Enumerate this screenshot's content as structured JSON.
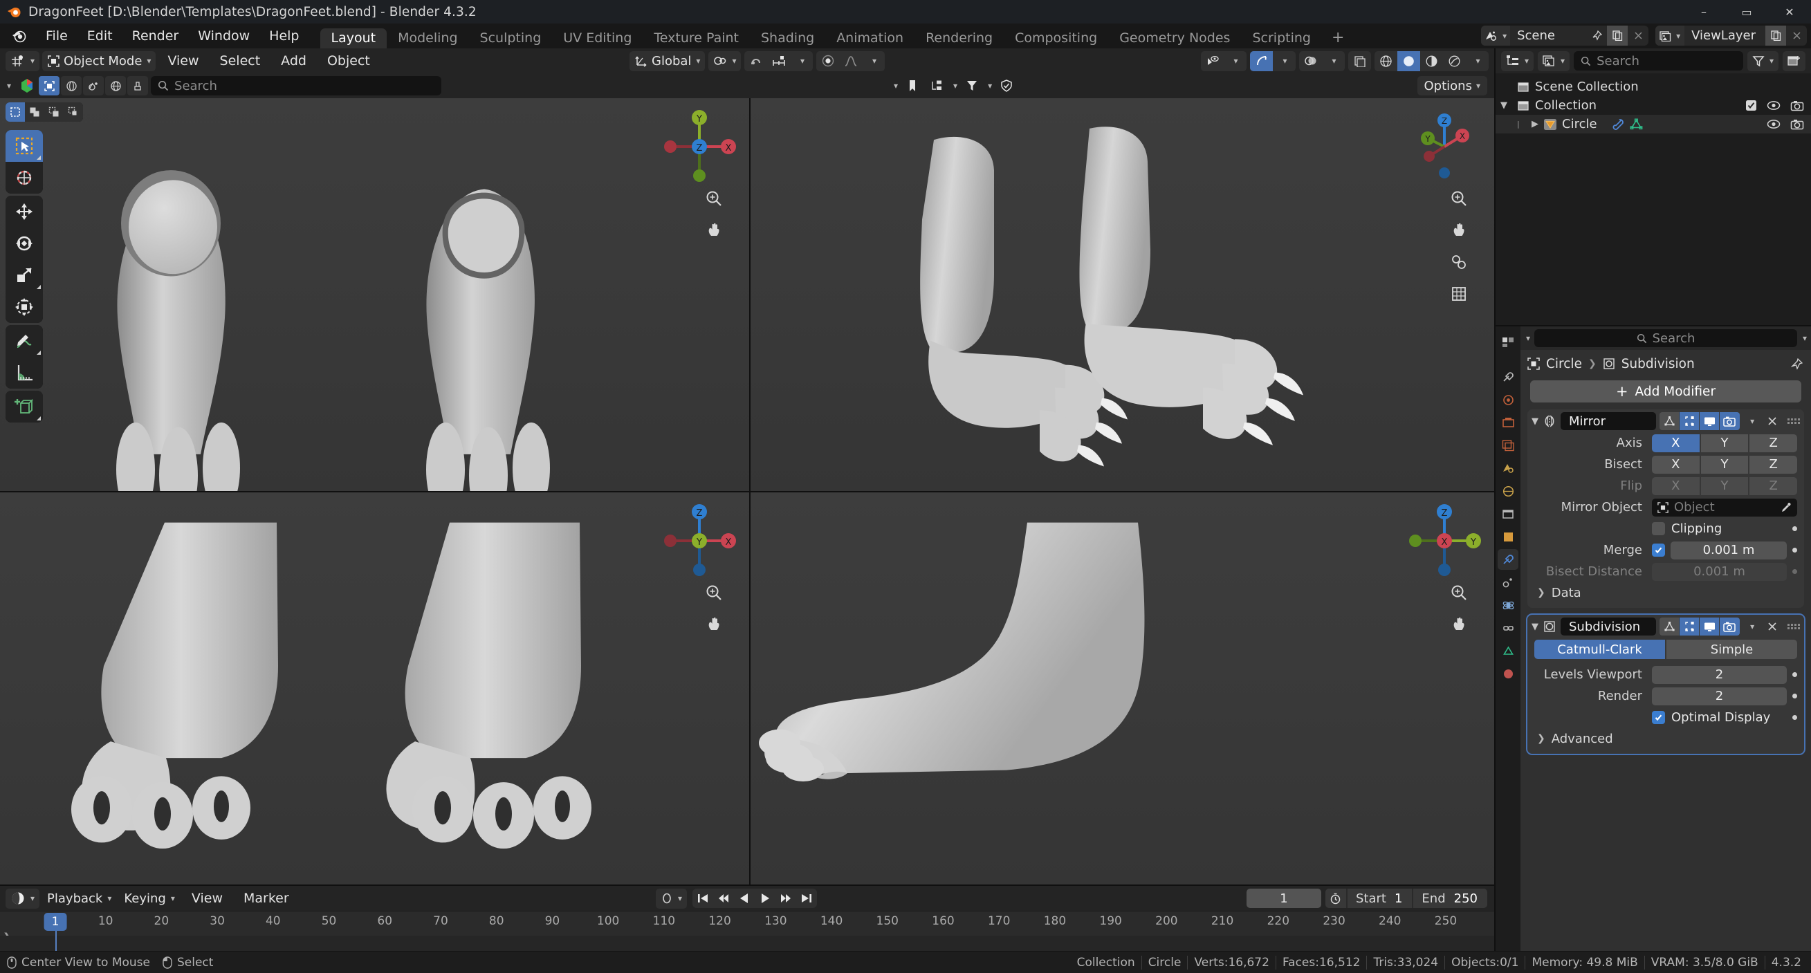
{
  "titlebar": {
    "title": "DragonFeet [D:\\Blender\\Templates\\DragonFeet.blend] - Blender 4.3.2",
    "minimize": "–",
    "maximize": "▭",
    "close": "✕"
  },
  "menubar": {
    "menus": [
      "File",
      "Edit",
      "Render",
      "Window",
      "Help"
    ],
    "workspaces": [
      {
        "label": "Layout",
        "active": true
      },
      {
        "label": "Modeling",
        "active": false
      },
      {
        "label": "Sculpting",
        "active": false
      },
      {
        "label": "UV Editing",
        "active": false
      },
      {
        "label": "Texture Paint",
        "active": false
      },
      {
        "label": "Shading",
        "active": false
      },
      {
        "label": "Animation",
        "active": false
      },
      {
        "label": "Rendering",
        "active": false
      },
      {
        "label": "Compositing",
        "active": false
      },
      {
        "label": "Geometry Nodes",
        "active": false
      },
      {
        "label": "Scripting",
        "active": false
      }
    ],
    "add_workspace": "+",
    "scene": {
      "name": "Scene"
    },
    "viewlayer": {
      "name": "ViewLayer"
    }
  },
  "viewport_header": {
    "mode": "Object Mode",
    "menus": [
      "View",
      "Select",
      "Add",
      "Object"
    ],
    "transform_orientation": "Global"
  },
  "viewport_search": {
    "placeholder": "Search",
    "options_label": "Options"
  },
  "outliner": {
    "search_placeholder": "Search",
    "rows": [
      {
        "label": "Scene Collection",
        "depth": 0,
        "expandable": false
      },
      {
        "label": "Collection",
        "depth": 1,
        "expandable": true
      },
      {
        "label": "Circle",
        "depth": 2,
        "expandable": true,
        "selected": true
      }
    ]
  },
  "properties": {
    "search_placeholder": "Search",
    "breadcrumb": [
      "Circle",
      "Subdivision"
    ],
    "add_modifier_label": "Add Modifier",
    "modifiers": [
      {
        "name": "Mirror",
        "selected": false,
        "axis_label": "Axis",
        "axis": [
          {
            "label": "X",
            "on": true
          },
          {
            "label": "Y",
            "on": false
          },
          {
            "label": "Z",
            "on": false
          }
        ],
        "bisect_label": "Bisect",
        "bisect": [
          {
            "label": "X",
            "on": false
          },
          {
            "label": "Y",
            "on": false
          },
          {
            "label": "Z",
            "on": false
          }
        ],
        "flip_label": "Flip",
        "flip": [
          {
            "label": "X",
            "on": false
          },
          {
            "label": "Y",
            "on": false
          },
          {
            "label": "Z",
            "on": false
          }
        ],
        "mirror_object_label": "Mirror Object",
        "mirror_object_placeholder": "Object",
        "clipping_label": "Clipping",
        "clipping_checked": false,
        "merge_label": "Merge",
        "merge_checked": true,
        "merge_value": "0.001 m",
        "bisect_distance_label": "Bisect Distance",
        "bisect_distance_value": "0.001 m",
        "data_label": "Data"
      },
      {
        "name": "Subdivision",
        "selected": true,
        "algorithm": [
          {
            "label": "Catmull-Clark",
            "on": true
          },
          {
            "label": "Simple",
            "on": false
          }
        ],
        "levels_viewport_label": "Levels Viewport",
        "levels_viewport_value": "2",
        "render_label": "Render",
        "render_value": "2",
        "optimal_display_label": "Optimal Display",
        "optimal_display_checked": true,
        "advanced_label": "Advanced"
      }
    ]
  },
  "timeline": {
    "menus": [
      "Playback",
      "Keying",
      "View",
      "Marker"
    ],
    "current_frame": "1",
    "start_label": "Start",
    "start_value": "1",
    "end_label": "End",
    "end_value": "250",
    "ticks": [
      1,
      10,
      20,
      30,
      40,
      50,
      60,
      70,
      80,
      90,
      100,
      110,
      120,
      130,
      140,
      150,
      160,
      170,
      180,
      190,
      200,
      210,
      220,
      230,
      240,
      250
    ],
    "playhead_frame": 1
  },
  "statusbar": {
    "left": [
      {
        "icon": "mouse-middle-icon",
        "label": "Center View to Mouse"
      },
      {
        "icon": "mouse-left-icon",
        "label": "Select"
      }
    ],
    "right": [
      "Collection",
      "Circle",
      "Verts:16,672",
      "Faces:16,512",
      "Tris:33,024",
      "Objects:0/1",
      "Memory: 49.8 MiB",
      "VRAM: 3.5/8.0 GiB",
      "4.3.2"
    ]
  },
  "colors": {
    "accent_blue": "#4772b3",
    "axis_x": "#cc4452",
    "axis_y": "#8caf2b",
    "axis_z": "#2f7fd1",
    "bg_dark": "#1d1d1d",
    "viewport_bg": "#393939"
  },
  "viewports": [
    {
      "name": "front-ortho-view",
      "gizmo_axes": [
        "X",
        "Y",
        "Z"
      ]
    },
    {
      "name": "user-perspective-view",
      "gizmo_axes": [
        "X",
        "Y",
        "Z"
      ]
    },
    {
      "name": "top-ortho-view",
      "gizmo_axes": [
        "X",
        "Y",
        "Z"
      ]
    },
    {
      "name": "right-ortho-view",
      "gizmo_axes": [
        "X",
        "Y",
        "Z"
      ]
    }
  ]
}
